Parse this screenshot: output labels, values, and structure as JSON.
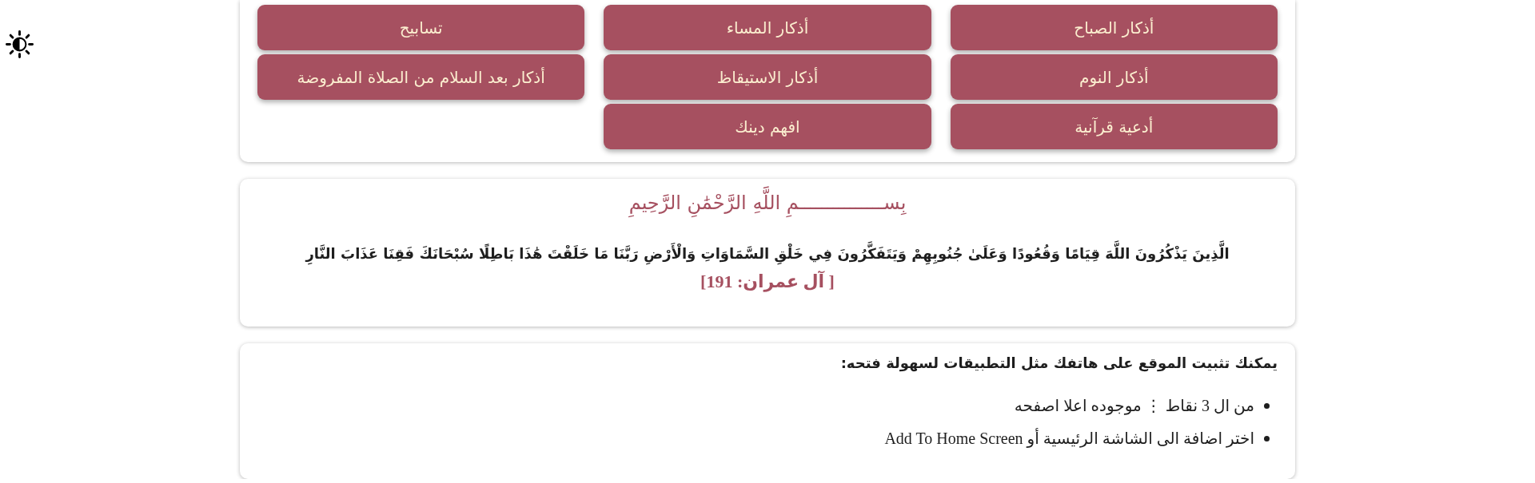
{
  "menu_buttons": [
    {
      "label": "أذكار الصباح"
    },
    {
      "label": "أذكار المساء"
    },
    {
      "label": "تسابيح"
    },
    {
      "label": "أذكار النوم"
    },
    {
      "label": "أذكار الاستيقاظ"
    },
    {
      "label": "أذكار بعد السلام من الصلاة المفروضة"
    },
    {
      "label": "أدعية قرآنية"
    },
    {
      "label": "افهم دينك"
    }
  ],
  "verse_card": {
    "basmala": "بِســـــــــــــــمِ اللَّهِ الرَّحْمَٰنِ الرَّحِيمِ",
    "verse": "الَّذِينَ يَذْكُرُونَ اللَّهَ قِيَامًا وَقُعُودًا وَعَلَىٰ جُنُوبِهِمْ وَيَتَفَكَّرُونَ فِي خَلْقِ السَّمَاوَاتِ وَالْأَرْضِ رَبَّنَا مَا خَلَقْتَ هَٰذَا بَاطِلًا سُبْحَانَكَ فَقِنَا عَذَابَ النَّارِ",
    "reference": "[ آل عمران: 191]"
  },
  "install_card": {
    "heading": "يمكنك تثبيت الموقع على هاتفك مثل التطبيقات لسهولة فتحه:",
    "steps": [
      "من ال 3 نقاط ⋮ موجوده اعلا اصفحه",
      "اختر اضافة الى الشاشة الرئيسية أو Add To Home Screen"
    ]
  }
}
